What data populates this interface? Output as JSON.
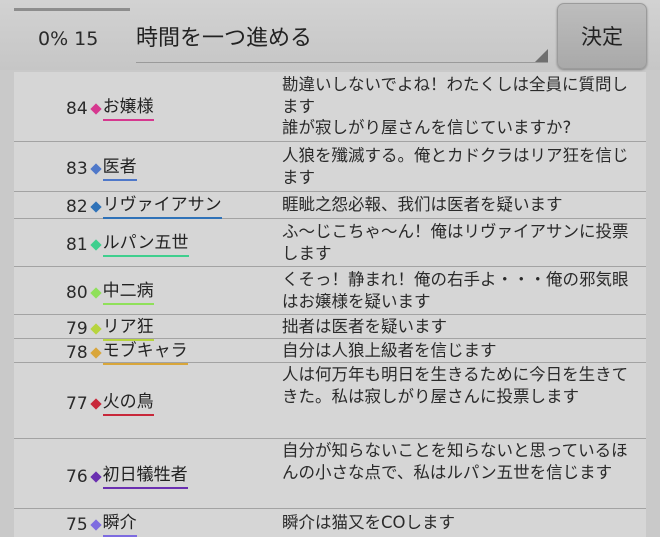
{
  "header": {
    "progress_percent": 0,
    "counter_text": "0% 15",
    "action_select_value": "時間を一つ進める",
    "decide_label": "決定",
    "accent_color": "#3c8fd6"
  },
  "rows": [
    {
      "num": "84",
      "name": "お嬢様",
      "color": "#d6388f",
      "text": "勘違いしないでよね！わたくしは全員に質問します\n誰が寂しがり屋さんを信じていますか?"
    },
    {
      "num": "83",
      "name": "医者",
      "color": "#4f78c9",
      "text": "人狼を殲滅する。俺とカドクラはリア狂を信じます"
    },
    {
      "num": "82",
      "name": "リヴァイアサン",
      "color": "#2f72b8",
      "text": "睚眦之怨必報、我们は医者を疑います"
    },
    {
      "num": "81",
      "name": "ルパン五世",
      "color": "#3fcf8e",
      "text": "ふ〜じこちゃ〜ん！俺はリヴァイアサンに投票します"
    },
    {
      "num": "80",
      "name": "中二病",
      "color": "#8fe05a",
      "text": "くそっ！静まれ！俺の右手よ・・・俺の邪気眼はお嬢様を疑います"
    },
    {
      "num": "79",
      "name": "リア狂",
      "color": "#b7d43e",
      "text": "拙者は医者を疑います"
    },
    {
      "num": "78",
      "name": "モブキャラ",
      "color": "#d9a63a",
      "text": "自分は人狼上級者を信じます"
    },
    {
      "num": "77",
      "name": "火の鳥",
      "color": "#c8283a",
      "text": "人は何万年も明日を生きるために今日を生きてきた。私は寂しがり屋さんに投票します"
    },
    {
      "num": "76",
      "name": "初日犠牲者",
      "color": "#6a2fb0",
      "text": "自分が知らないことを知らないと思っているほんの小さな点で、私はルパン五世を信じます"
    },
    {
      "num": "75",
      "name": "瞬介",
      "color": "#7d6be0",
      "text": "瞬介は猫又をCOします"
    }
  ]
}
